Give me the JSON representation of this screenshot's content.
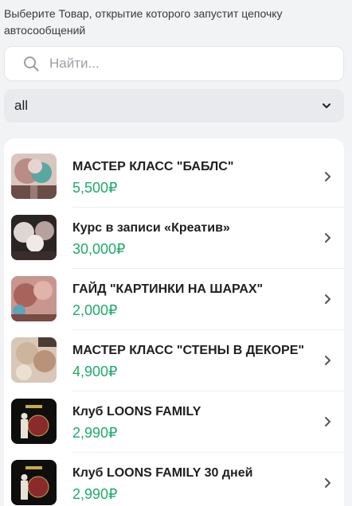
{
  "hint_text": "Выберите Товар, открытие которого запустит цепочку автосообщений",
  "search": {
    "placeholder": "Найти...",
    "value": "",
    "icon": "search-icon"
  },
  "filter": {
    "selected": "all",
    "icon": "chevron-down-icon"
  },
  "colors": {
    "price": "#1faa6b",
    "background": "#f2f3f5",
    "card": "#ffffff"
  },
  "products": [
    {
      "name": "МАСТЕР КЛАСС \"БАБЛС\"",
      "price": "5,500₽"
    },
    {
      "name": "Курс в записи «Креатив»",
      "price": "30,000₽"
    },
    {
      "name": "ГАЙД \"КАРТИНКИ НА ШАРАХ\"",
      "price": "2,000₽"
    },
    {
      "name": "МАСТЕР КЛАСС \"СТЕНЫ В ДЕКОРЕ\"",
      "price": "4,900₽"
    },
    {
      "name": "Клуб LOONS FAMILY",
      "price": "2,990₽"
    },
    {
      "name": "Клуб LOONS FAMILY 30 дней",
      "price": "2,990₽"
    }
  ]
}
